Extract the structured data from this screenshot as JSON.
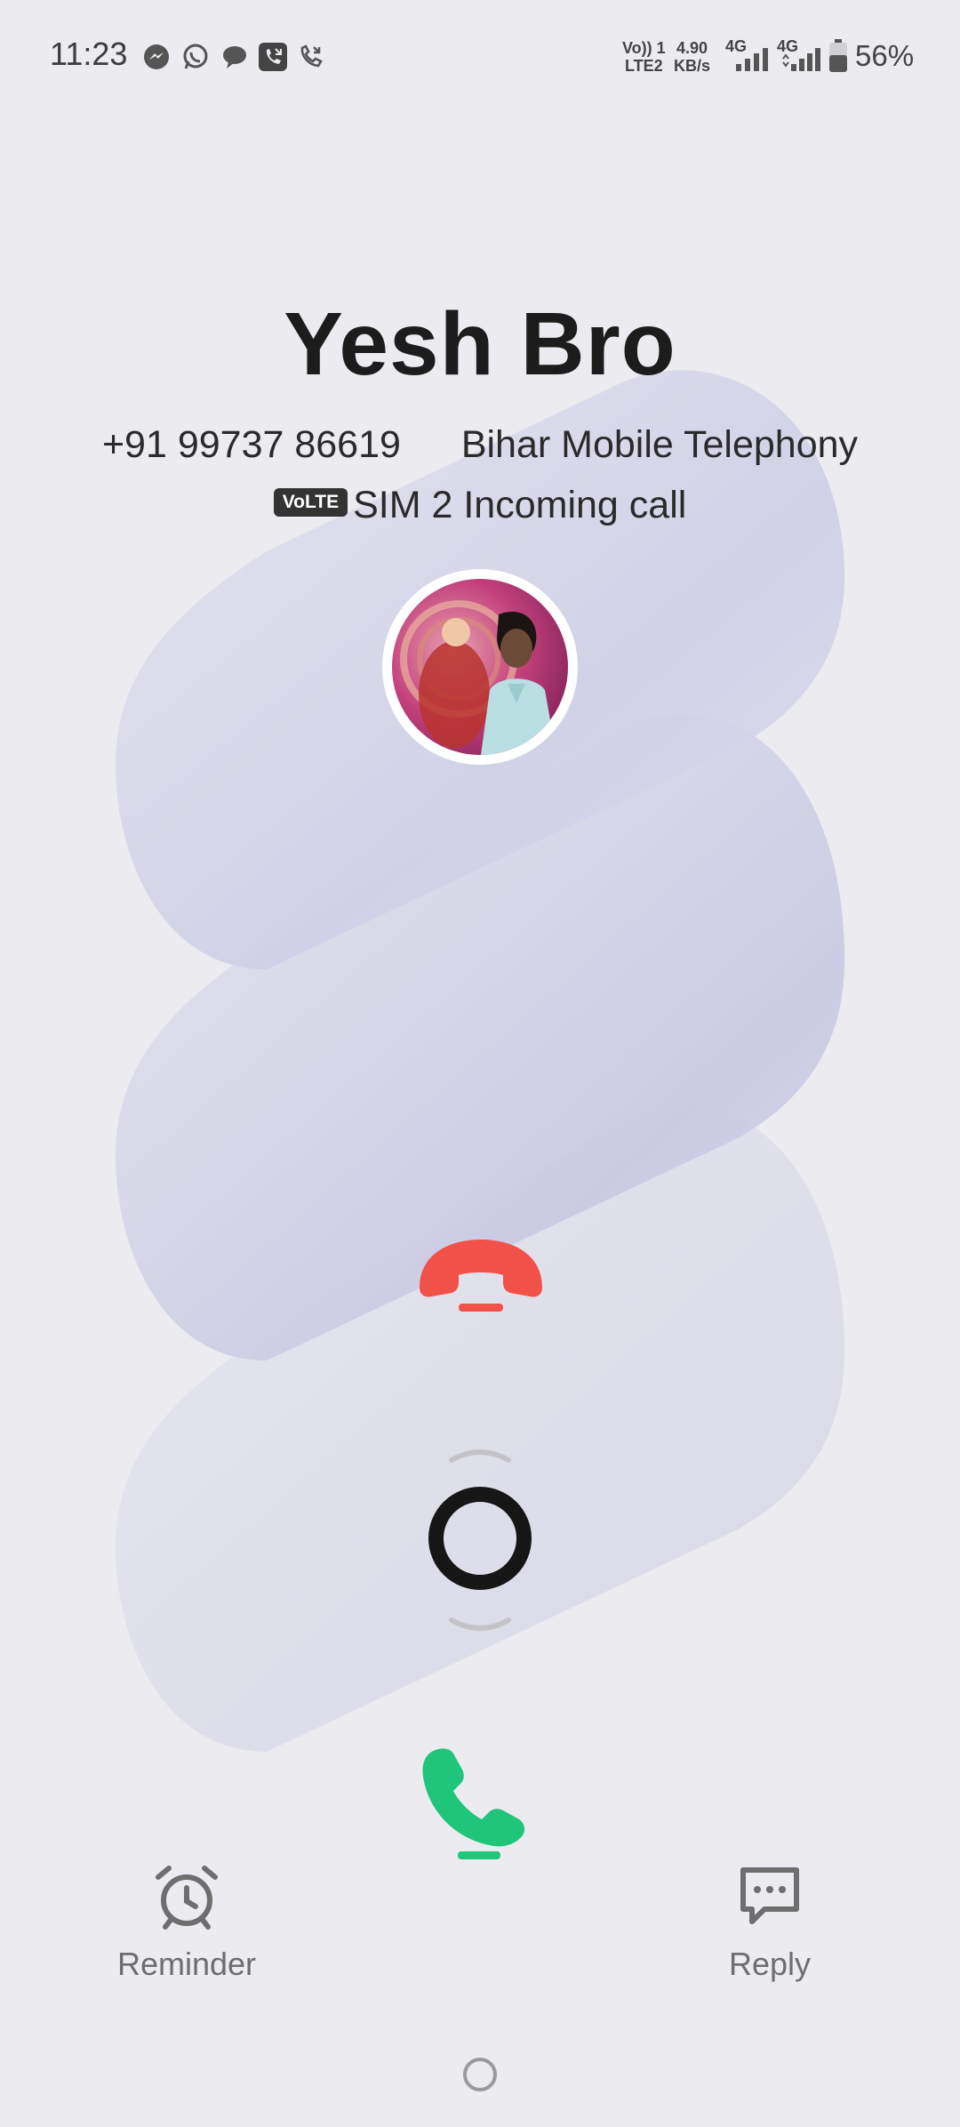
{
  "status_bar": {
    "time": "11:23",
    "notification_icons": [
      "messenger-icon",
      "whatsapp-icon",
      "chat-bubble-icon",
      "missed-call-icon",
      "call-forward-icon"
    ],
    "volte_line1": "Vo)) 1",
    "volte_line2": "LTE2",
    "speed_value": "4.90",
    "speed_unit": "KB/s",
    "sim1_type": "4G",
    "sim2_type": "4G",
    "battery": "56%"
  },
  "call": {
    "name": "Yesh Bro",
    "number": "+91 99737 86619",
    "carrier": "Bihar Mobile Telephony",
    "volte_badge": "VoLTE",
    "status": "SIM 2 Incoming call"
  },
  "actions": {
    "reminder_label": "Reminder",
    "reply_label": "Reply"
  },
  "colors": {
    "background": "#ebebf0",
    "decline": "#f2514a",
    "accept": "#1fc57a"
  }
}
